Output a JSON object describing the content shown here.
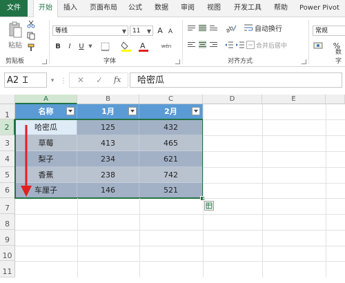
{
  "ribbon": {
    "tabs": [
      "文件",
      "开始",
      "插入",
      "页面布局",
      "公式",
      "数据",
      "审阅",
      "视图",
      "开发工具",
      "帮助",
      "Power Pivot"
    ],
    "active_tab": "开始",
    "clipboard": {
      "paste_label": "粘贴",
      "group_label": "剪贴板"
    },
    "font": {
      "family": "等线",
      "size": "11",
      "grow_label": "A",
      "shrink_label": "A",
      "bold": "B",
      "italic": "I",
      "underline": "U",
      "wen_label": "wén",
      "group_label": "字体"
    },
    "alignment": {
      "wrap_label": "自动换行",
      "merge_label": "合并后居中",
      "group_label": "对齐方式"
    },
    "number": {
      "format": "常规",
      "percent": "%",
      "group_label": "数字"
    }
  },
  "formula_bar": {
    "name_box": "A2",
    "fx": "fx",
    "content": "哈密瓜"
  },
  "grid": {
    "columns": [
      "A",
      "B",
      "C",
      "D",
      "E"
    ],
    "rows": [
      "1",
      "2",
      "3",
      "4",
      "5",
      "6",
      "7",
      "8",
      "9",
      "10",
      "11"
    ],
    "header": [
      "名称",
      "1月",
      "2月"
    ],
    "data": [
      [
        "哈密瓜",
        "125",
        "432"
      ],
      [
        "草莓",
        "413",
        "465"
      ],
      [
        "梨子",
        "234",
        "621"
      ],
      [
        "香蕉",
        "238",
        "742"
      ],
      [
        "车厘子",
        "146",
        "521"
      ]
    ],
    "active_cell": "A2"
  },
  "colors": {
    "accent": "#217346",
    "table_header": "#5b9bd5",
    "band": "#a3b1c6",
    "arrow": "#e02020"
  }
}
